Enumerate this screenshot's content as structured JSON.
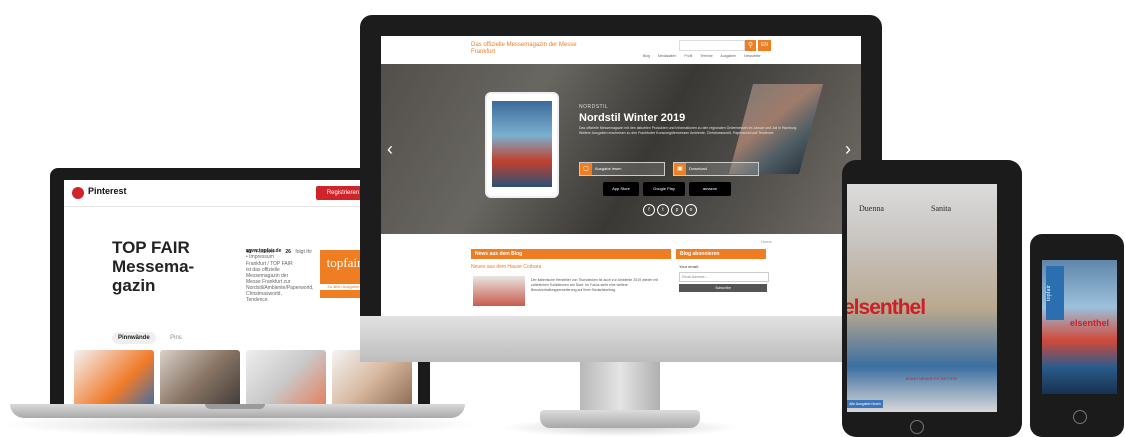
{
  "laptop": {
    "brand": "Pinterest",
    "register_label": "Registrieren",
    "board_title": "TOP FAIR Messema-gazin",
    "stats": [
      {
        "value": "41",
        "label": "Follower"
      },
      {
        "value": "26",
        "label": "folgt Ihr"
      }
    ],
    "site_link": "www.topfair.de",
    "site_handle": "• Impressum",
    "description": "Frankfurt / TOP FAIR ist das offizielle Messemagazin der Messe Frankfurt zur Nordstil/Ambiente/Paperworld, Christmasworld, Tendence",
    "logo_text": "topfair",
    "logo_sub": "Zu allen Ausgaben",
    "tabs": [
      "Pinnwände",
      "Pins"
    ]
  },
  "monitor": {
    "site_title": "Das offizielle Messemagazin der Messe Frankfurt",
    "lang": "EN",
    "nav": [
      "Blog",
      "Mediadaten",
      "Profil",
      "Termine",
      "Ausgaben",
      "Newsletter"
    ],
    "hero_kicker": "NORDSTIL",
    "hero_title": "Nordstil Winter 2019",
    "hero_body": "Das offizielle Messemagazin mit den aktuellen Produkten und Informationen zu den regionalen Ordermessen im Januar und Juli in Hamburg. Weitere Ausgaben erscheinen zu den Frankfurter Konsumgütermessen Ambiente, Christmasworld, Paperworld und Tendence.",
    "select1": "Ausgabe lesen",
    "select2": "Download",
    "stores": [
      "App Store",
      "Google Play",
      "amazon"
    ],
    "social": [
      "f",
      "t",
      "p",
      "o"
    ],
    "breadcrumb": "Home",
    "blog_header": "News aus dem Blog",
    "blog_link": "Neues aus dem Hause Corbara",
    "blog_text": "Der italienische Hersteller von Tischdecken ist auch zur Ambiente 2019 wieder mit zahlreichen Kollektionen am Start. Im Fokus steht eine weitere Benutzerhaltungserweiterung auf Ihren Bedarfsbeitrag.",
    "abo_header": "Blog abonnieren",
    "abo_label": "Your email:",
    "abo_placeholder": "Email-Adresse...",
    "abo_button": "Subscribe"
  },
  "tablet": {
    "name_left": "Duenna",
    "name_right": "Sanita",
    "red_text": "elsenthel",
    "bottom_line": "JEANS NEVER FIT BETTER",
    "cta": "Alle Ausgaben lesen"
  },
  "phone": {
    "logo_text": "topfair",
    "red_text": "elsenthel"
  },
  "colors": {
    "accent": "#ef7d22",
    "pinterest_red": "#d0242b",
    "brand_red": "#c9202a"
  }
}
